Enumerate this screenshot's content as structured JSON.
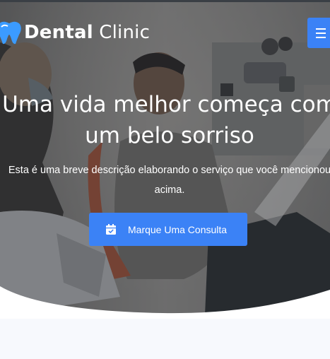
{
  "brand": {
    "name_bold": "Dental",
    "name_light": " Clinic",
    "logo_icon": "tooth-icon"
  },
  "nav": {
    "menu_icon": "hamburger-menu-icon"
  },
  "hero": {
    "headline_line1": "Uma vida melhor começa com",
    "headline_line2": "um belo sorriso",
    "description_line1": "Esta é uma breve descrição elaborando o serviço que você mencionou",
    "description_line2": "acima.",
    "cta_label": "Marque Uma Consulta",
    "cta_icon": "calendar-check-icon"
  },
  "colors": {
    "accent": "#3b82f6",
    "text_on_dark": "#ffffff",
    "page_background": "#ffffff",
    "section_background": "#f7f9fd"
  }
}
